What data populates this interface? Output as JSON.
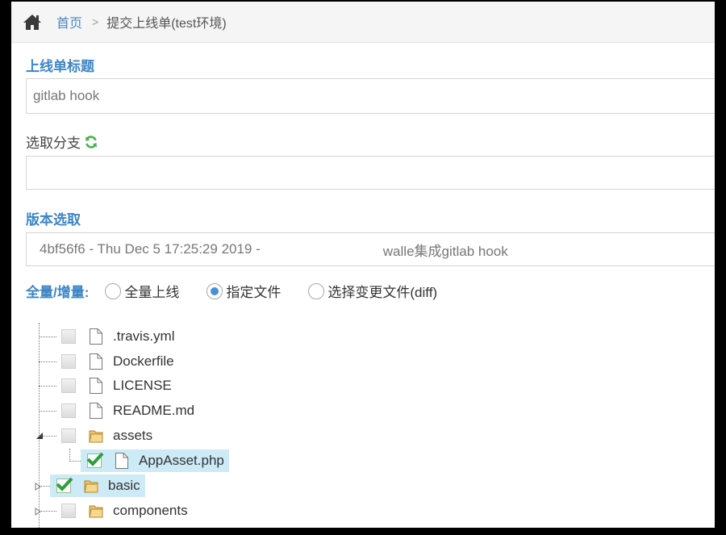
{
  "breadcrumb": {
    "home": "首页",
    "separator": ">",
    "current": "提交上线单(test环境)"
  },
  "form": {
    "title_label": "上线单标题",
    "title_value": "gitlab hook",
    "branch_label": "选取分支",
    "branch_value": "",
    "version_label": "版本选取",
    "version_hash": "4bf56f6 - Thu Dec 5 17:25:29 2019 -",
    "version_message": "walle集成gitlab hook",
    "mode_label": "全量/增量:",
    "mode_options": [
      "全量上线",
      "指定文件",
      "选择变更文件(diff)"
    ],
    "mode_selected_index": 1
  },
  "tree": {
    "items": [
      {
        "name": ".travis.yml",
        "type": "file",
        "checked": false
      },
      {
        "name": "Dockerfile",
        "type": "file",
        "checked": false
      },
      {
        "name": "LICENSE",
        "type": "file",
        "checked": false
      },
      {
        "name": "README.md",
        "type": "file",
        "checked": false
      },
      {
        "name": "assets",
        "type": "folder",
        "checked": false,
        "expanded": true
      },
      {
        "name": "AppAsset.php",
        "type": "file",
        "checked": true,
        "child": true
      },
      {
        "name": "basic",
        "type": "folder",
        "checked": true,
        "expanded": false
      },
      {
        "name": "components",
        "type": "folder",
        "checked": false,
        "expanded": false
      }
    ]
  },
  "colors": {
    "accent": "#3d85c6",
    "selection": "#cdeaf7",
    "refresh": "#4caf50",
    "check": "#2e9e3b"
  }
}
